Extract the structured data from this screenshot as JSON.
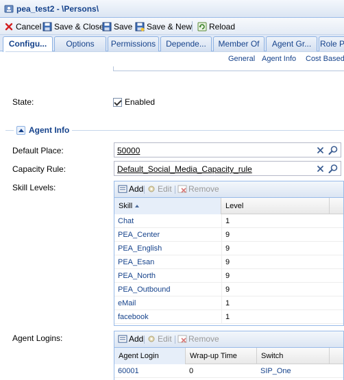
{
  "window": {
    "title": "pea_test2 - \\Persons\\"
  },
  "toolbar": {
    "cancel": "Cancel",
    "save_close": "Save & Close",
    "save": "Save",
    "save_new": "Save & New",
    "reload": "Reload"
  },
  "tabs": [
    "Configu...",
    "Options",
    "Permissions",
    "Depende...",
    "Member Of",
    "Agent Gr...",
    "Role P"
  ],
  "section_links": [
    "General",
    "Agent Info",
    "Cost Based"
  ],
  "state": {
    "label": "State:",
    "checkbox_label": "Enabled",
    "checked": true
  },
  "agent_info": {
    "legend": "Agent Info",
    "default_place": {
      "label": "Default Place:",
      "value": "50000"
    },
    "capacity_rule": {
      "label": "Capacity Rule:",
      "value": "Default_Social_Media_Capacity_rule"
    },
    "skill_levels": {
      "label": "Skill Levels:",
      "add": "Add",
      "edit": "Edit",
      "remove": "Remove",
      "columns": [
        "Skill",
        "Level"
      ],
      "rows": [
        {
          "skill": "Chat",
          "level": "1"
        },
        {
          "skill": "PEA_Center",
          "level": "9"
        },
        {
          "skill": "PEA_English",
          "level": "9"
        },
        {
          "skill": "PEA_Esan",
          "level": "9"
        },
        {
          "skill": "PEA_North",
          "level": "9"
        },
        {
          "skill": "PEA_Outbound",
          "level": "9"
        },
        {
          "skill": "eMail",
          "level": "1"
        },
        {
          "skill": "facebook",
          "level": "1"
        }
      ]
    },
    "agent_logins": {
      "label": "Agent Logins:",
      "add": "Add",
      "edit": "Edit",
      "remove": "Remove",
      "columns": [
        "Agent Login",
        "Wrap-up Time",
        "Switch"
      ],
      "rows": [
        {
          "login": "60001",
          "wrapup": "0",
          "switch": "SIP_One"
        }
      ]
    }
  },
  "colors": {
    "accent": "#15428b",
    "border": "#99bbe8",
    "header_bg": "#dfe8f6"
  }
}
